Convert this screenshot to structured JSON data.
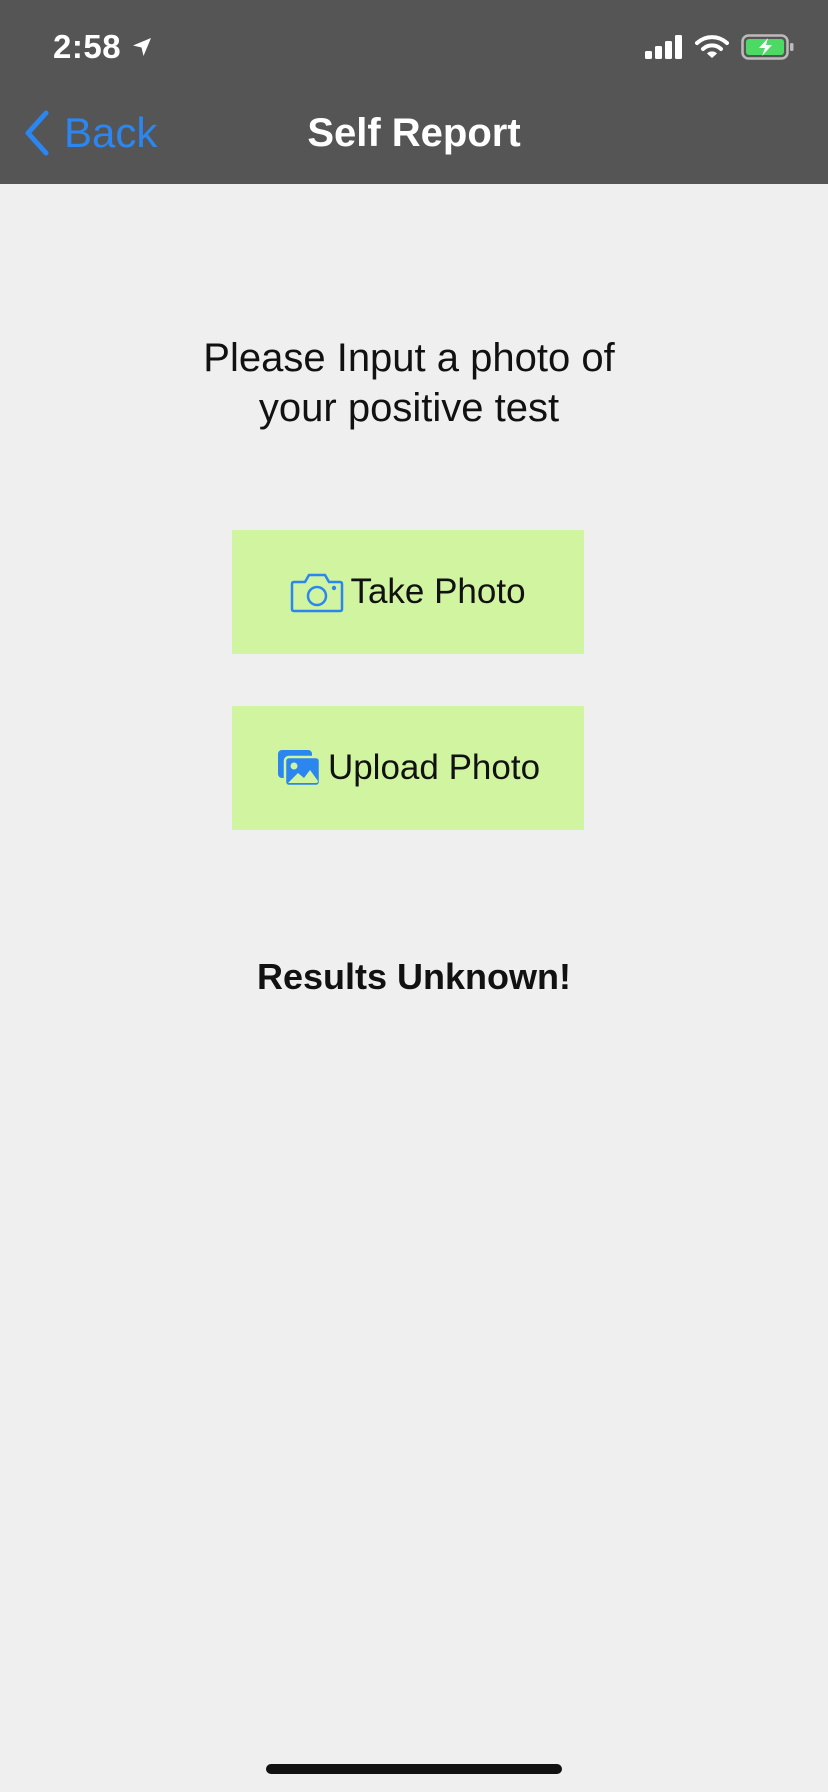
{
  "status_bar": {
    "time": "2:58"
  },
  "nav": {
    "back_label": "Back",
    "title": "Self Report"
  },
  "main": {
    "prompt": "Please Input a photo of your positive test",
    "take_photo_label": "Take Photo",
    "upload_photo_label": "Upload Photo",
    "result_text": "Results Unknown!"
  },
  "icons": {
    "back": "chevron-left-icon",
    "location": "location-arrow-icon",
    "signal": "cellular-signal-icon",
    "wifi": "wifi-icon",
    "battery": "battery-charging-icon",
    "camera": "camera-icon",
    "photos": "photo-library-icon"
  },
  "colors": {
    "header_bg": "#555555",
    "page_bg": "#efefef",
    "accent_blue": "#2b86f0",
    "button_bg": "#d0f49f",
    "battery_green": "#4cd964"
  }
}
